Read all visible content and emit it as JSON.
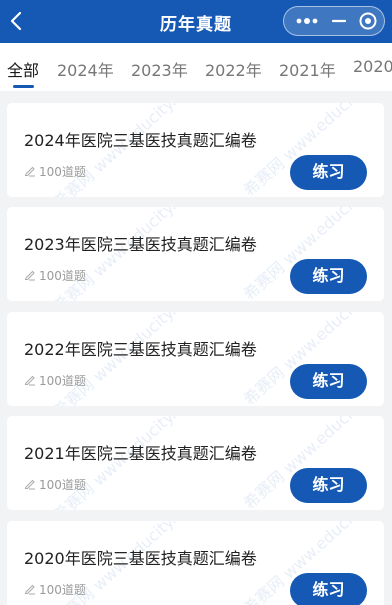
{
  "navbar": {
    "title": "历年真题",
    "back_icon": "chevron-left-icon",
    "more_icon": "more-dots-icon",
    "minimize_icon": "minimize-icon",
    "close_icon": "target-close-icon"
  },
  "tabs": [
    {
      "label": "全部",
      "active": true
    },
    {
      "label": "2024年",
      "active": false
    },
    {
      "label": "2023年",
      "active": false
    },
    {
      "label": "2022年",
      "active": false
    },
    {
      "label": "2021年",
      "active": false
    },
    {
      "label": "2020",
      "active": false
    }
  ],
  "exams": [
    {
      "title": "2024年医院三基医技真题汇编卷",
      "count": "100道题",
      "button": "练习"
    },
    {
      "title": "2023年医院三基医技真题汇编卷",
      "count": "100道题",
      "button": "练习"
    },
    {
      "title": "2022年医院三基医技真题汇编卷",
      "count": "100道题",
      "button": "练习"
    },
    {
      "title": "2021年医院三基医技真题汇编卷",
      "count": "100道题",
      "button": "练习"
    },
    {
      "title": "2020年医院三基医技真题汇编卷",
      "count": "100道题",
      "button": "练习"
    }
  ],
  "watermark": "希赛网 www.educity.cn",
  "colors": {
    "brand": "#1559b4",
    "background": "#f2f3f5"
  }
}
